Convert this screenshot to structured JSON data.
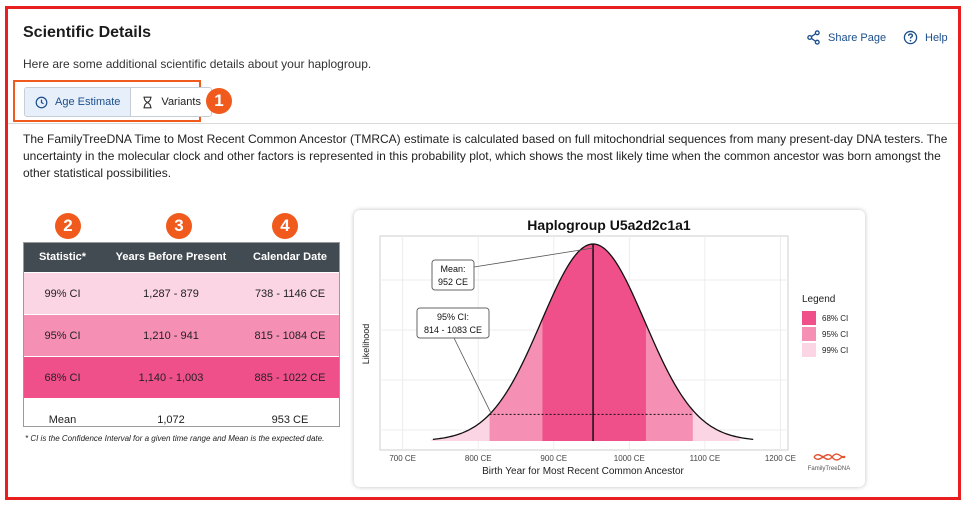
{
  "page": {
    "title": "Scientific Details",
    "subtitle": "Here are some additional scientific details about your haplogroup.",
    "share_label": "Share Page",
    "help_label": "Help",
    "tabs": [
      {
        "label": "Age Estimate",
        "icon": "clock-icon",
        "active": true
      },
      {
        "label": "Variants",
        "icon": "hourglass-icon",
        "active": false
      }
    ],
    "description": "The FamilyTreeDNA Time to Most Recent Common Ancestor (TMRCA) estimate is calculated based on full mitochondrial sequences from many present-day DNA testers. The uncertainty in the molecular clock and other factors is represented in this probability plot, which shows the most likely time when the common ancestor was born amongst the other statistical possibilities.",
    "badges": [
      "1",
      "2",
      "3",
      "4"
    ],
    "accent_color": "#f05a1c"
  },
  "table": {
    "headers": [
      "Statistic*",
      "Years Before Present",
      "Calendar Date"
    ],
    "rows": [
      {
        "stat": "99% CI",
        "years": "1,287 - 879",
        "date": "738 - 1146 CE"
      },
      {
        "stat": "95% CI",
        "years": "1,210 - 941",
        "date": "815 - 1084 CE"
      },
      {
        "stat": "68% CI",
        "years": "1,140 - 1,003",
        "date": "885 - 1022 CE"
      },
      {
        "stat": "Mean",
        "years": "1,072",
        "date": "953 CE"
      }
    ],
    "footnote": "* CI is the Confidence Interval for a given time range and Mean is the expected date."
  },
  "chart_data": {
    "type": "area",
    "title": "Haplogroup U5a2d2c1a1",
    "xlabel": "Birth Year for Most Recent Common Ancestor",
    "ylabel": "Likelihood",
    "xlim": [
      670,
      1210
    ],
    "xticks": [
      700,
      800,
      900,
      1000,
      1100,
      1200
    ],
    "xtick_labels": [
      "700 CE",
      "800 CE",
      "900 CE",
      "1000 CE",
      "1100 CE",
      "1200 CE"
    ],
    "mean": 952,
    "bands": [
      {
        "name": "99% CI",
        "range": [
          738,
          1146
        ],
        "color": "#fbd5e3"
      },
      {
        "name": "95% CI",
        "range": [
          815,
          1084
        ],
        "color": "#f58fb4"
      },
      {
        "name": "68% CI",
        "range": [
          885,
          1022
        ],
        "color": "#f0508a"
      }
    ],
    "annotations": [
      {
        "lines": [
          "Mean:",
          "952 CE"
        ]
      },
      {
        "lines": [
          "95% CI:",
          "814 - 1083 CE"
        ]
      }
    ],
    "legend_title": "Legend",
    "legend": [
      {
        "label": "68% CI",
        "color": "#f0508a"
      },
      {
        "label": "95% CI",
        "color": "#f58fb4"
      },
      {
        "label": "99% CI",
        "color": "#fbd5e3"
      }
    ],
    "logo_text": "FamilyTreeDNA",
    "grid": true,
    "legend_position": "right"
  }
}
